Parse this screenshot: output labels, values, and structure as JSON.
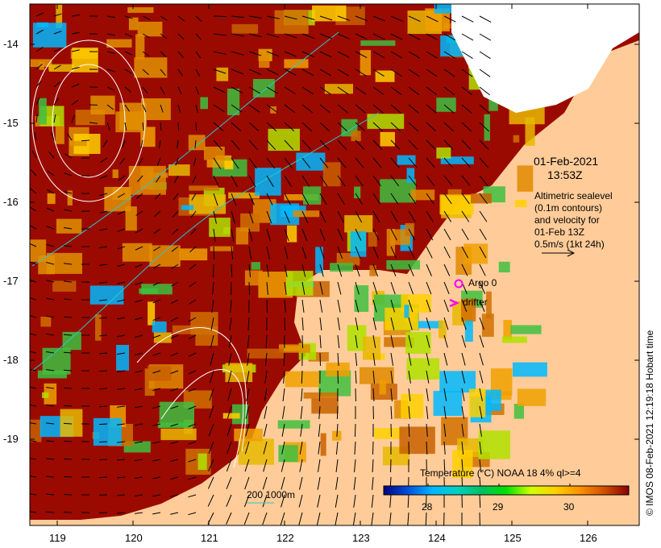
{
  "map": {
    "date": "01-Feb-2021",
    "time": "13:53Z",
    "legend_lines": [
      "Altimetric sealevel",
      "(0.1m contours)",
      "and velocity for",
      "01-Feb 13Z",
      "0.5m/s (1kt 24h)"
    ],
    "argo_label": "Argo 0",
    "drifter_label": "drifter",
    "scale_label": "200  1000m",
    "credit": "© IMOS 08-Feb-2021 12:19:18 Hobart time",
    "x_ticks": [
      "119",
      "120",
      "121",
      "122",
      "123",
      "124",
      "125",
      "126"
    ],
    "y_ticks": [
      "-14",
      "-15",
      "-16",
      "-17",
      "-18",
      "-19"
    ],
    "colorbar": {
      "title": "Temperature (°C) NOAA 18 4% ql>=4",
      "ticks": [
        "28",
        "29",
        "30"
      ],
      "range": [
        27.4,
        30.8
      ],
      "colors": [
        "#00007f",
        "#0050e0",
        "#00b8ff",
        "#00d0c0",
        "#00c060",
        "#00e000",
        "#d0ff00",
        "#ffd000",
        "#ff9000",
        "#d05000",
        "#8b0000"
      ]
    },
    "colors": {
      "land": "#ffcc99",
      "ocean_warm": "#9b0a00",
      "argo": "#ff00ff"
    }
  }
}
